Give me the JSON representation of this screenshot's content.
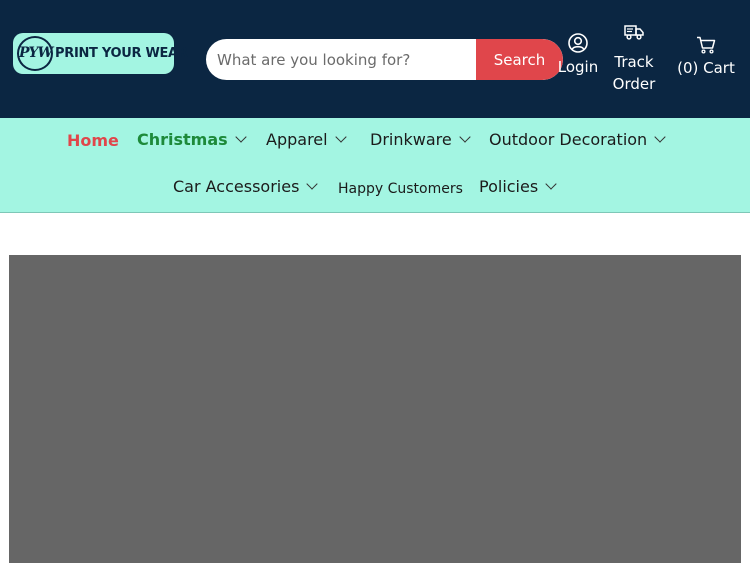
{
  "brand": {
    "logo_mark": "PYW",
    "logo_text": "PRINT YOUR WEAR",
    "colors": {
      "header_bg": "#0b2642",
      "nav_bg": "#a3f5e2",
      "accent": "#e0464b",
      "christmas": "#1d8a3a",
      "banner_bg": "#666666"
    }
  },
  "search": {
    "placeholder": "What are you looking for?",
    "button_label": "Search"
  },
  "header_links": {
    "login": {
      "label": "Login",
      "icon": "user-circle-icon"
    },
    "track": {
      "label_line1": "Track",
      "label_line2": "Order",
      "icon": "truck-icon"
    },
    "cart": {
      "label": "(0) Cart",
      "icon": "cart-icon"
    }
  },
  "nav": {
    "home": "Home",
    "christmas": "Christmas",
    "apparel": "Apparel",
    "drinkware": "Drinkware",
    "outdoor": "Outdoor Decoration",
    "car": "Car Accessories",
    "happy": "Happy Customers",
    "policies": "Policies"
  }
}
